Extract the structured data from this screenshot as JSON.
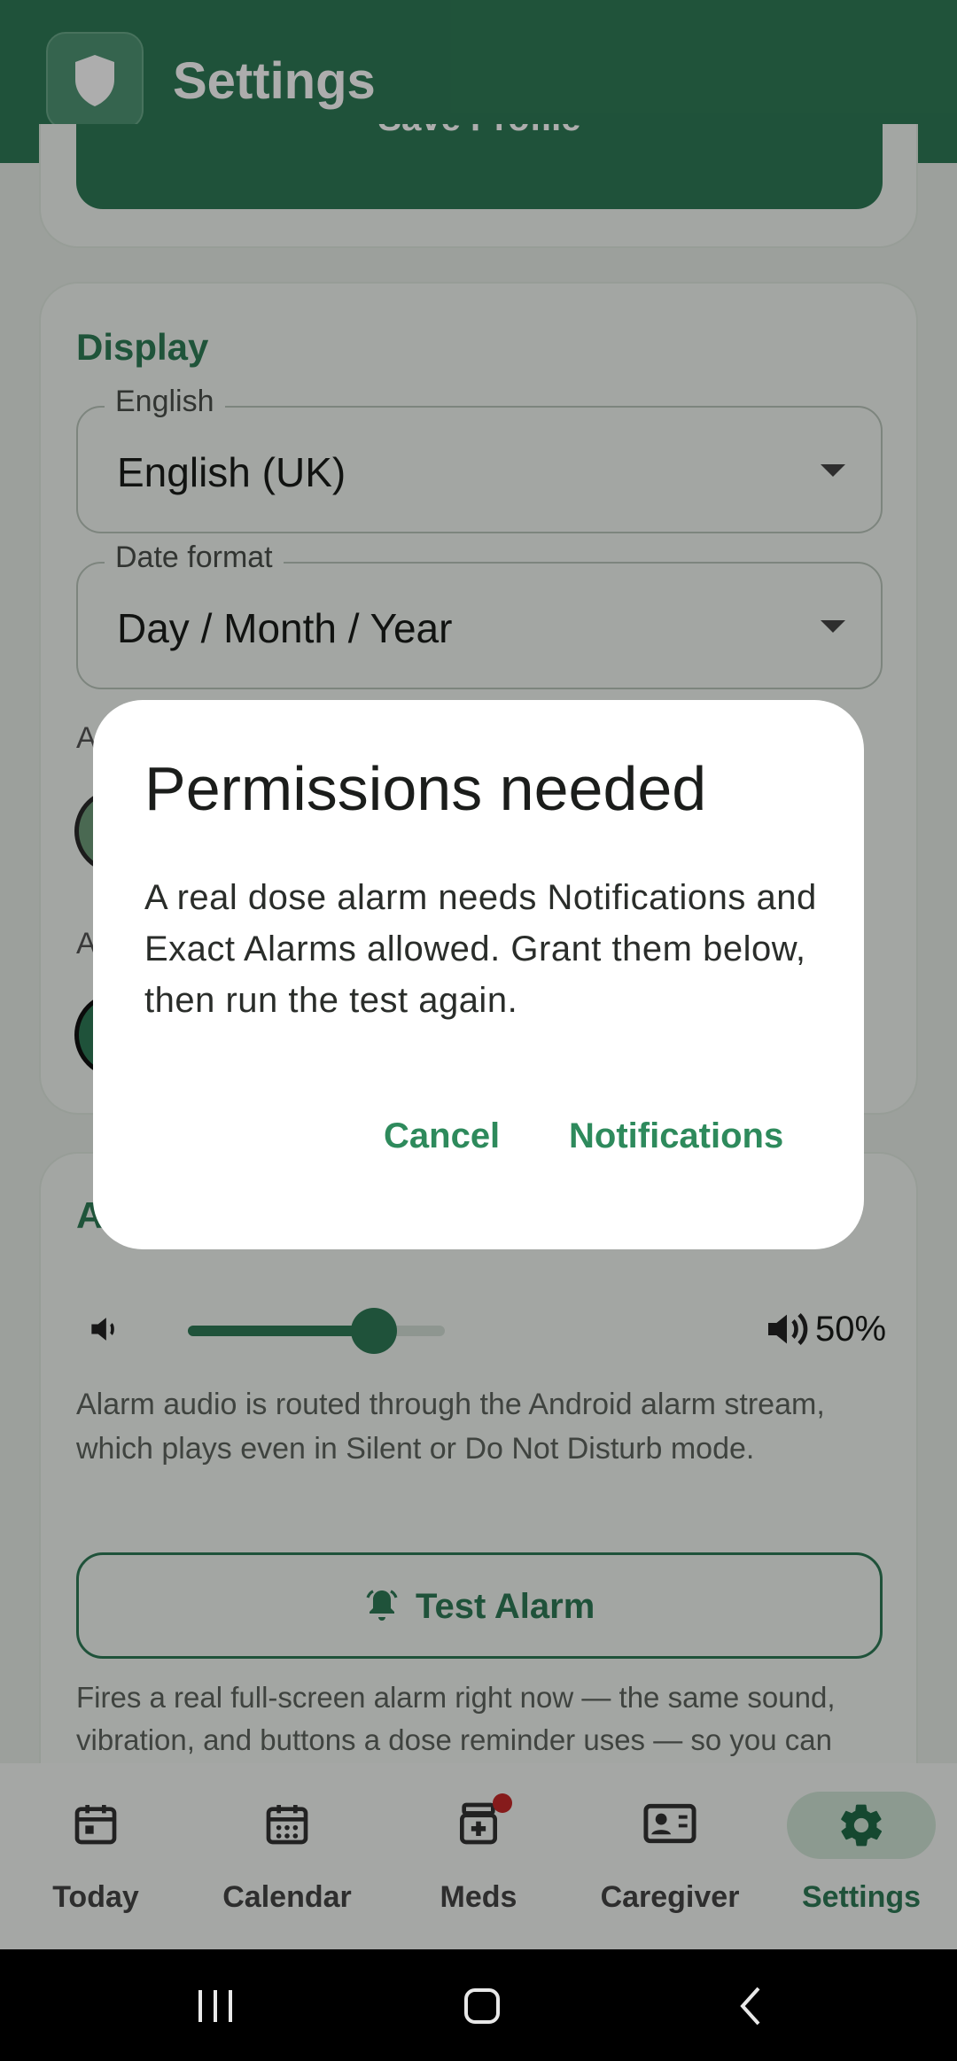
{
  "app_bar": {
    "title": "Settings",
    "logo_icon": "shield-icon"
  },
  "profile_card": {
    "save_label": "Save Profile"
  },
  "display_card": {
    "title": "Display",
    "language": {
      "label": "English",
      "value": "English (UK)"
    },
    "date_format": {
      "label": "Date format",
      "value": "Day / Month / Year"
    },
    "row1_partial": "A",
    "row2_partial": "A"
  },
  "alarm_card": {
    "title_partial": "A",
    "volume_percent": 50,
    "volume_text": "50%",
    "description": "Alarm audio is routed through the Android alarm stream, which plays even in Silent or Do Not Disturb mode.",
    "test_button": "Test Alarm",
    "footnote": "Fires a real full-screen alarm right now — the same sound, vibration, and buttons a dose reminder uses — so you can"
  },
  "dialog": {
    "title": "Permissions needed",
    "body": "A real dose alarm needs Notifications and Exact Alarms allowed. Grant them below, then run the test again.",
    "cancel": "Cancel",
    "confirm": "Notifications"
  },
  "bottom_nav": {
    "items": [
      {
        "label": "Today",
        "icon": "calendar-today-icon"
      },
      {
        "label": "Calendar",
        "icon": "calendar-month-icon"
      },
      {
        "label": "Meds",
        "icon": "medication-icon"
      },
      {
        "label": "Caregiver",
        "icon": "contact-card-icon"
      },
      {
        "label": "Settings",
        "icon": "gear-icon"
      }
    ],
    "active": "Settings"
  },
  "colors": {
    "primary": "#2f7a56",
    "accent_text": "#2e8a5c",
    "badge": "#c62828"
  }
}
